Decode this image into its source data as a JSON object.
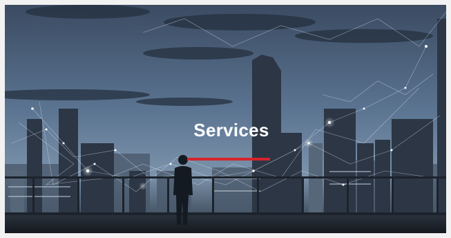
{
  "hero": {
    "title": "Services",
    "accent_color": "#d8222a",
    "background_description_icon": "city-skyline-network-icon"
  }
}
